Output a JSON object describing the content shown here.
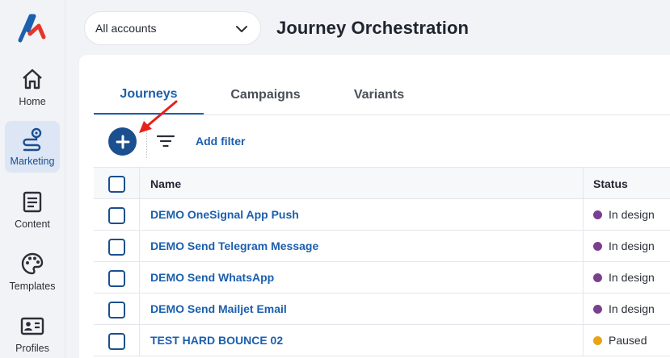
{
  "sidebar": {
    "items": [
      {
        "label": "Home",
        "icon": "home-icon"
      },
      {
        "label": "Marketing",
        "icon": "marketing-route-icon"
      },
      {
        "label": "Content",
        "icon": "content-document-icon"
      },
      {
        "label": "Templates",
        "icon": "palette-icon"
      },
      {
        "label": "Profiles",
        "icon": "profile-card-icon"
      }
    ]
  },
  "header": {
    "account_selector": "All accounts",
    "title": "Journey Orchestration"
  },
  "tabs": [
    "Journeys",
    "Campaigns",
    "Variants"
  ],
  "toolbar": {
    "add_filter": "Add filter"
  },
  "table": {
    "columns": [
      "Name",
      "Status"
    ],
    "rows": [
      {
        "name": "DEMO OneSignal App Push",
        "status": "In design",
        "status_color": "#7b3f8f"
      },
      {
        "name": "DEMO Send Telegram Message",
        "status": "In design",
        "status_color": "#7b3f8f"
      },
      {
        "name": "DEMO Send WhatsApp",
        "status": "In design",
        "status_color": "#7b3f8f"
      },
      {
        "name": "DEMO Send Mailjet Email",
        "status": "In design",
        "status_color": "#7b3f8f"
      },
      {
        "name": "TEST HARD BOUNCE 02",
        "status": "Paused",
        "status_color": "#e8a317"
      }
    ]
  },
  "colors": {
    "accent": "#1b4f8f",
    "link": "#1b5fad",
    "logo_red": "#e5352b"
  }
}
